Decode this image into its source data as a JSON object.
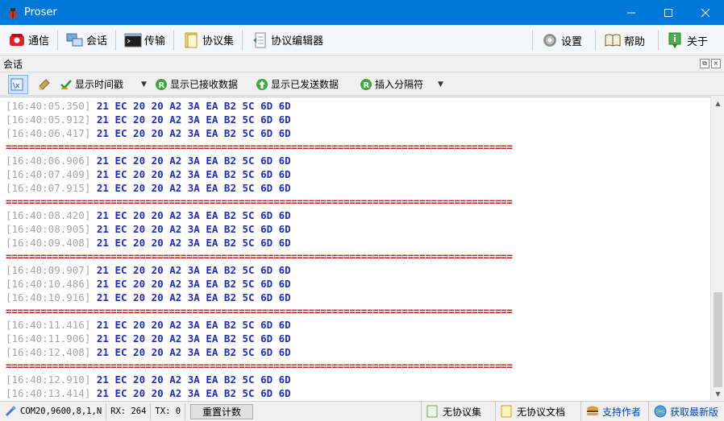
{
  "window": {
    "title": "Proser"
  },
  "toolbar": {
    "items": [
      {
        "label": "通信",
        "icon": "phone-icon"
      },
      {
        "label": "会话",
        "icon": "session-icon"
      },
      {
        "label": "传输",
        "icon": "terminal-icon"
      },
      {
        "label": "协议集",
        "icon": "folder-icon"
      },
      {
        "label": "协议编辑器",
        "icon": "editor-icon"
      },
      {
        "label": "设置",
        "icon": "gear-icon"
      },
      {
        "label": "帮助",
        "icon": "book-icon"
      },
      {
        "label": "关于",
        "icon": "info-icon"
      }
    ]
  },
  "panel": {
    "title": "会话"
  },
  "subbar": {
    "show_timestamp": "显示时间戳",
    "show_received": "显示已接收数据",
    "show_sent": "显示已发送数据",
    "insert_separator": "插入分隔符"
  },
  "log": {
    "separator": "==========================================================================================",
    "entries": [
      {
        "time": "[16:40:05.350]",
        "data": "21 EC 20 20 A2 3A EA B2 5C 6D 6D"
      },
      {
        "time": "[16:40:05.912]",
        "data": "21 EC 20 20 A2 3A EA B2 5C 6D 6D"
      },
      {
        "time": "[16:40:06.417]",
        "data": "21 EC 20 20 A2 3A EA B2 5C 6D 6D"
      },
      {
        "sep": true
      },
      {
        "time": "[16:40:06.906]",
        "data": "21 EC 20 20 A2 3A EA B2 5C 6D 6D"
      },
      {
        "time": "[16:40:07.409]",
        "data": "21 EC 20 20 A2 3A EA B2 5C 6D 6D"
      },
      {
        "time": "[16:40:07.915]",
        "data": "21 EC 20 20 A2 3A EA B2 5C 6D 6D"
      },
      {
        "sep": true
      },
      {
        "time": "[16:40:08.420]",
        "data": "21 EC 20 20 A2 3A EA B2 5C 6D 6D"
      },
      {
        "time": "[16:40:08.905]",
        "data": "21 EC 20 20 A2 3A EA B2 5C 6D 6D"
      },
      {
        "time": "[16:40:09.408]",
        "data": "21 EC 20 20 A2 3A EA B2 5C 6D 6D"
      },
      {
        "sep": true
      },
      {
        "time": "[16:40:09.907]",
        "data": "21 EC 20 20 A2 3A EA B2 5C 6D 6D"
      },
      {
        "time": "[16:40:10.486]",
        "data": "21 EC 20 20 A2 3A EA B2 5C 6D 6D"
      },
      {
        "time": "[16:40:10.916]",
        "data": "21 EC 20 20 A2 3A EA B2 5C 6D 6D"
      },
      {
        "sep": true
      },
      {
        "time": "[16:40:11.416]",
        "data": "21 EC 20 20 A2 3A EA B2 5C 6D 6D"
      },
      {
        "time": "[16:40:11.906]",
        "data": "21 EC 20 20 A2 3A EA B2 5C 6D 6D"
      },
      {
        "time": "[16:40:12.408]",
        "data": "21 EC 20 20 A2 3A EA B2 5C 6D 6D"
      },
      {
        "sep": true
      },
      {
        "time": "[16:40:12.910]",
        "data": "21 EC 20 20 A2 3A EA B2 5C 6D 6D"
      },
      {
        "time": "[16:40:13.414]",
        "data": "21 EC 20 20 A2 3A EA B2 5C 6D 6D"
      }
    ]
  },
  "status": {
    "port": "COM20,9600,8,1,N",
    "rx": "RX: 264",
    "tx": "TX: 0",
    "reset_label": "重置计数",
    "no_protocol_set": "无协议集",
    "no_protocol_doc": "无协议文档",
    "support_author": "支持作者",
    "get_latest": "获取最新版"
  },
  "colors": {
    "titlebar": "#0078d7",
    "timestamp": "#a6a6a6",
    "hex": "#1f2fb3",
    "separator": "#d01414"
  }
}
